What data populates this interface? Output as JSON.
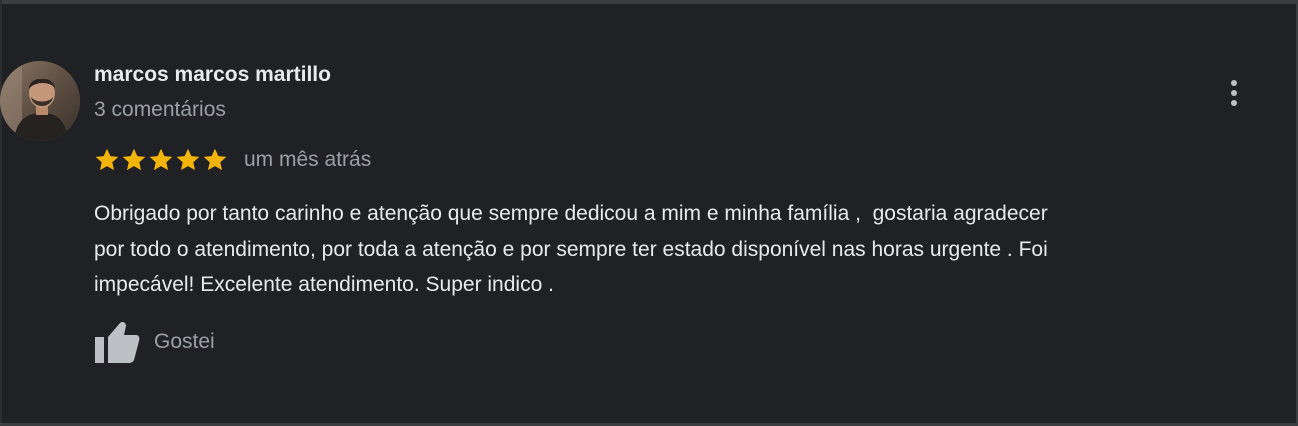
{
  "review": {
    "author": {
      "name": "marcos marcos martillo",
      "meta": "3 comentários",
      "avatar_icon": "profile-photo"
    },
    "rating": {
      "stars": 5,
      "max_stars": 5,
      "star_color": "#f4b400"
    },
    "time": "um mês atrás",
    "text": "Obrigado por tanto carinho e atenção que sempre dedicou a mim e minha família ,  gostaria agradecer\npor todo o atendimento, por toda a atenção e por sempre ter estado disponível nas horas urgente . Foi\nimpecável! Excelente atendimento. Super indico .",
    "actions": {
      "like_label": "Gostei",
      "like_icon": "thumbs-up-icon",
      "menu_icon": "more-vert-icon"
    }
  },
  "colors": {
    "background": "#202124",
    "primary_text": "#e8eaed",
    "secondary_text": "#9aa0a6",
    "icon": "#bdc1c6"
  }
}
